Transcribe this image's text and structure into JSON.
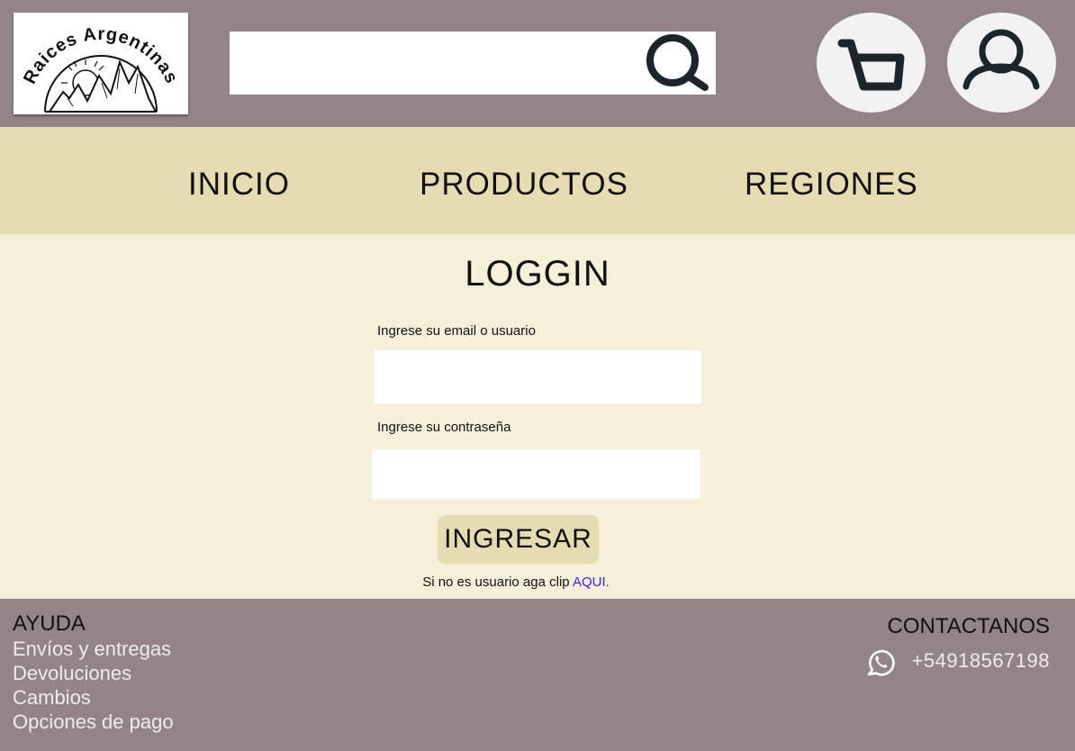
{
  "header": {
    "logo": {
      "brand_text": "Raices Argentinas",
      "icon": "mountain-sun-logo"
    },
    "search": {
      "placeholder": "",
      "value": "",
      "icon": "search-icon"
    },
    "cart_icon": "cart-icon",
    "user_icon": "user-icon"
  },
  "nav": {
    "items": [
      {
        "label": "INICIO"
      },
      {
        "label": "PRODUCTOS"
      },
      {
        "label": "REGIONES"
      }
    ]
  },
  "login": {
    "title": "LOGGIN",
    "email_label": "Ingrese su email o usuario",
    "email_value": "",
    "password_label": "Ingrese su contraseña",
    "password_value": "",
    "submit_label": "INGRESAR",
    "register_text": "Si no es usuario aga clip ",
    "register_link": "AQUI."
  },
  "footer": {
    "help_title": "AYUDA",
    "help_links": [
      "Envíos y entregas",
      "Devoluciones",
      "Cambios",
      "Opciones de pago"
    ],
    "contact_title": "CONTACTANOS",
    "contact_icon": "whatsapp-icon",
    "phone": "+54918567198"
  },
  "colors": {
    "header_bg": "#938587",
    "nav_bg": "#e5dcb4",
    "main_bg": "#f6efda",
    "link": "#3b1ff2",
    "footer_text_light": "#f1ecec"
  }
}
